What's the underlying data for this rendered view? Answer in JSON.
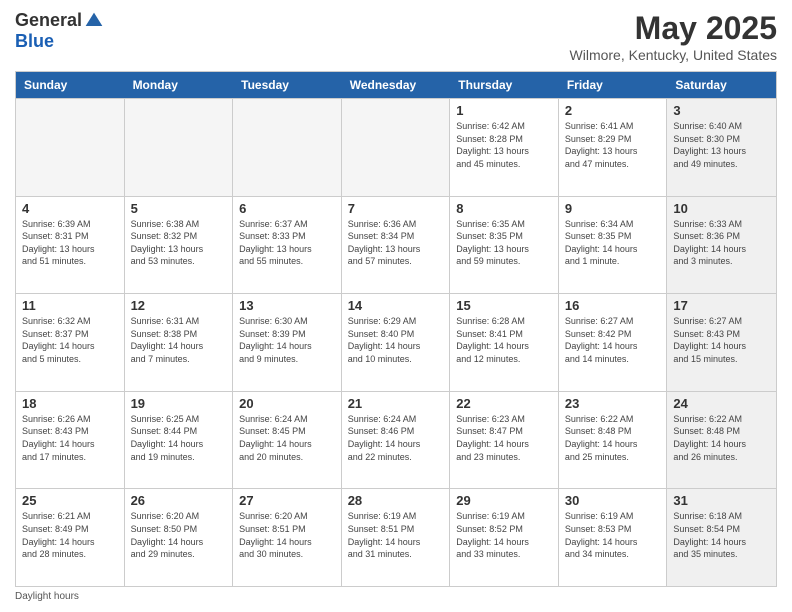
{
  "logo": {
    "general": "General",
    "blue": "Blue"
  },
  "title": "May 2025",
  "subtitle": "Wilmore, Kentucky, United States",
  "calendar": {
    "headers": [
      "Sunday",
      "Monday",
      "Tuesday",
      "Wednesday",
      "Thursday",
      "Friday",
      "Saturday"
    ],
    "weeks": [
      [
        {
          "day": "",
          "info": "",
          "empty": true
        },
        {
          "day": "",
          "info": "",
          "empty": true
        },
        {
          "day": "",
          "info": "",
          "empty": true
        },
        {
          "day": "",
          "info": "",
          "empty": true
        },
        {
          "day": "1",
          "info": "Sunrise: 6:42 AM\nSunset: 8:28 PM\nDaylight: 13 hours\nand 45 minutes.",
          "empty": false
        },
        {
          "day": "2",
          "info": "Sunrise: 6:41 AM\nSunset: 8:29 PM\nDaylight: 13 hours\nand 47 minutes.",
          "empty": false
        },
        {
          "day": "3",
          "info": "Sunrise: 6:40 AM\nSunset: 8:30 PM\nDaylight: 13 hours\nand 49 minutes.",
          "empty": false,
          "shaded": true
        }
      ],
      [
        {
          "day": "4",
          "info": "Sunrise: 6:39 AM\nSunset: 8:31 PM\nDaylight: 13 hours\nand 51 minutes.",
          "empty": false
        },
        {
          "day": "5",
          "info": "Sunrise: 6:38 AM\nSunset: 8:32 PM\nDaylight: 13 hours\nand 53 minutes.",
          "empty": false
        },
        {
          "day": "6",
          "info": "Sunrise: 6:37 AM\nSunset: 8:33 PM\nDaylight: 13 hours\nand 55 minutes.",
          "empty": false
        },
        {
          "day": "7",
          "info": "Sunrise: 6:36 AM\nSunset: 8:34 PM\nDaylight: 13 hours\nand 57 minutes.",
          "empty": false
        },
        {
          "day": "8",
          "info": "Sunrise: 6:35 AM\nSunset: 8:35 PM\nDaylight: 13 hours\nand 59 minutes.",
          "empty": false
        },
        {
          "day": "9",
          "info": "Sunrise: 6:34 AM\nSunset: 8:35 PM\nDaylight: 14 hours\nand 1 minute.",
          "empty": false
        },
        {
          "day": "10",
          "info": "Sunrise: 6:33 AM\nSunset: 8:36 PM\nDaylight: 14 hours\nand 3 minutes.",
          "empty": false,
          "shaded": true
        }
      ],
      [
        {
          "day": "11",
          "info": "Sunrise: 6:32 AM\nSunset: 8:37 PM\nDaylight: 14 hours\nand 5 minutes.",
          "empty": false
        },
        {
          "day": "12",
          "info": "Sunrise: 6:31 AM\nSunset: 8:38 PM\nDaylight: 14 hours\nand 7 minutes.",
          "empty": false
        },
        {
          "day": "13",
          "info": "Sunrise: 6:30 AM\nSunset: 8:39 PM\nDaylight: 14 hours\nand 9 minutes.",
          "empty": false
        },
        {
          "day": "14",
          "info": "Sunrise: 6:29 AM\nSunset: 8:40 PM\nDaylight: 14 hours\nand 10 minutes.",
          "empty": false
        },
        {
          "day": "15",
          "info": "Sunrise: 6:28 AM\nSunset: 8:41 PM\nDaylight: 14 hours\nand 12 minutes.",
          "empty": false
        },
        {
          "day": "16",
          "info": "Sunrise: 6:27 AM\nSunset: 8:42 PM\nDaylight: 14 hours\nand 14 minutes.",
          "empty": false
        },
        {
          "day": "17",
          "info": "Sunrise: 6:27 AM\nSunset: 8:43 PM\nDaylight: 14 hours\nand 15 minutes.",
          "empty": false,
          "shaded": true
        }
      ],
      [
        {
          "day": "18",
          "info": "Sunrise: 6:26 AM\nSunset: 8:43 PM\nDaylight: 14 hours\nand 17 minutes.",
          "empty": false
        },
        {
          "day": "19",
          "info": "Sunrise: 6:25 AM\nSunset: 8:44 PM\nDaylight: 14 hours\nand 19 minutes.",
          "empty": false
        },
        {
          "day": "20",
          "info": "Sunrise: 6:24 AM\nSunset: 8:45 PM\nDaylight: 14 hours\nand 20 minutes.",
          "empty": false
        },
        {
          "day": "21",
          "info": "Sunrise: 6:24 AM\nSunset: 8:46 PM\nDaylight: 14 hours\nand 22 minutes.",
          "empty": false
        },
        {
          "day": "22",
          "info": "Sunrise: 6:23 AM\nSunset: 8:47 PM\nDaylight: 14 hours\nand 23 minutes.",
          "empty": false
        },
        {
          "day": "23",
          "info": "Sunrise: 6:22 AM\nSunset: 8:48 PM\nDaylight: 14 hours\nand 25 minutes.",
          "empty": false
        },
        {
          "day": "24",
          "info": "Sunrise: 6:22 AM\nSunset: 8:48 PM\nDaylight: 14 hours\nand 26 minutes.",
          "empty": false,
          "shaded": true
        }
      ],
      [
        {
          "day": "25",
          "info": "Sunrise: 6:21 AM\nSunset: 8:49 PM\nDaylight: 14 hours\nand 28 minutes.",
          "empty": false
        },
        {
          "day": "26",
          "info": "Sunrise: 6:20 AM\nSunset: 8:50 PM\nDaylight: 14 hours\nand 29 minutes.",
          "empty": false
        },
        {
          "day": "27",
          "info": "Sunrise: 6:20 AM\nSunset: 8:51 PM\nDaylight: 14 hours\nand 30 minutes.",
          "empty": false
        },
        {
          "day": "28",
          "info": "Sunrise: 6:19 AM\nSunset: 8:51 PM\nDaylight: 14 hours\nand 31 minutes.",
          "empty": false
        },
        {
          "day": "29",
          "info": "Sunrise: 6:19 AM\nSunset: 8:52 PM\nDaylight: 14 hours\nand 33 minutes.",
          "empty": false
        },
        {
          "day": "30",
          "info": "Sunrise: 6:19 AM\nSunset: 8:53 PM\nDaylight: 14 hours\nand 34 minutes.",
          "empty": false
        },
        {
          "day": "31",
          "info": "Sunrise: 6:18 AM\nSunset: 8:54 PM\nDaylight: 14 hours\nand 35 minutes.",
          "empty": false,
          "shaded": true
        }
      ]
    ]
  },
  "footer": {
    "daylight_label": "Daylight hours"
  }
}
